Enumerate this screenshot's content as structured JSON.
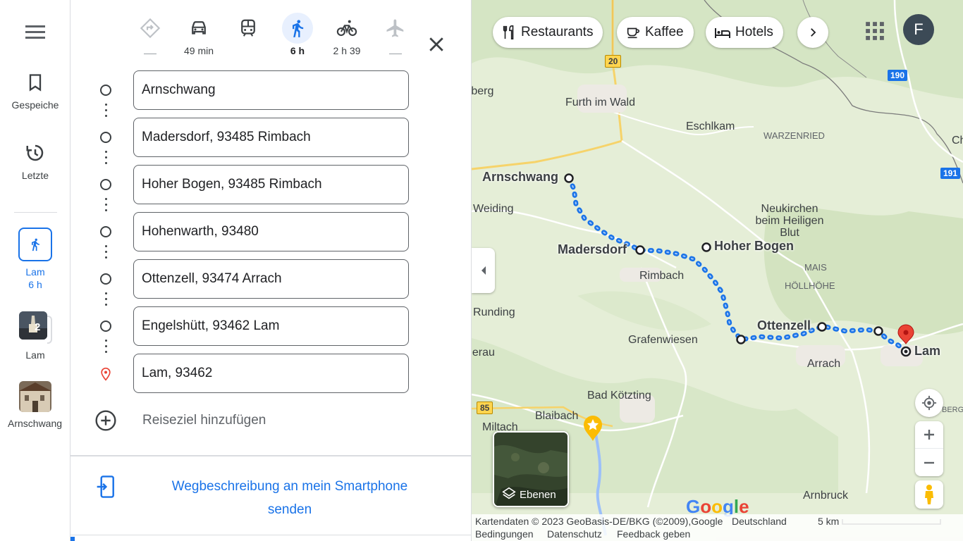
{
  "rail": {
    "saved_label": "Gespeiche",
    "recent_label": "Letzte",
    "recents": [
      {
        "label": "Lam",
        "sub": "6 h"
      },
      {
        "label": "Lam",
        "badge": "2"
      },
      {
        "label": "Arnschwang"
      }
    ]
  },
  "modes": {
    "car_time": "49 min",
    "walk_time": "6 h",
    "bike_time": "2 h 39"
  },
  "stops": [
    "Arnschwang",
    "Madersdorf, 93485 Rimbach",
    "Hoher Bogen, 93485 Rimbach",
    "Hohenwarth, 93480",
    "Ottenzell, 93474 Arrach",
    "Engelshütt, 93462 Lam",
    "Lam, 93462"
  ],
  "add_destination": "Reiseziel hinzufügen",
  "send_to_phone": "Wegbeschreibung an mein Smartphone senden",
  "chips": {
    "restaurants": "Restaurants",
    "coffee": "Kaffee",
    "hotels": "Hotels"
  },
  "account_initial": "F",
  "layers_label": "Ebenen",
  "map_labels": {
    "furth": "Furth im Wald",
    "eschlkam": "Eschlkam",
    "warzenried": "WARZENRIED",
    "neukirchen": "Neukirchen beim Heiligen Blut",
    "weiding": "Weiding",
    "rimbach": "Rimbach",
    "mais": "MAIS",
    "hoellhoehe": "HÖLLHÖHE",
    "runding": "Runding",
    "grafenwiesen": "Grafenwiesen",
    "arrach": "Arrach",
    "bad_koetzting": "Bad Kötzting",
    "blaibach": "Blaibach",
    "miltach": "Miltach",
    "arnbruck": "Arnbruck",
    "berg_left": "rberg",
    "erau": "herau",
    "ch": "Ch",
    "berg_right": "BERG",
    "route_arnschwang": "Arnschwang",
    "route_madersdorf": "Madersdorf",
    "route_hoher_bogen": "Hoher Bogen",
    "route_ottenzell": "Ottenzell",
    "route_lam": "Lam"
  },
  "road_shields": {
    "b20": "20",
    "b85": "85",
    "b190": "190",
    "b191": "191"
  },
  "google": "Google",
  "footer": {
    "mapdata": "Kartendaten © 2023 GeoBasis-DE/BKG (©2009),Google",
    "country": "Deutschland",
    "scale": "5 km",
    "terms": "Bedingungen",
    "privacy": "Datenschutz",
    "feedback": "Feedback geben"
  },
  "colors": {
    "accent": "#1a73e8",
    "route": "#1a73e8",
    "map_bg": "#e5eed7",
    "destination_pin": "#ea4335"
  }
}
